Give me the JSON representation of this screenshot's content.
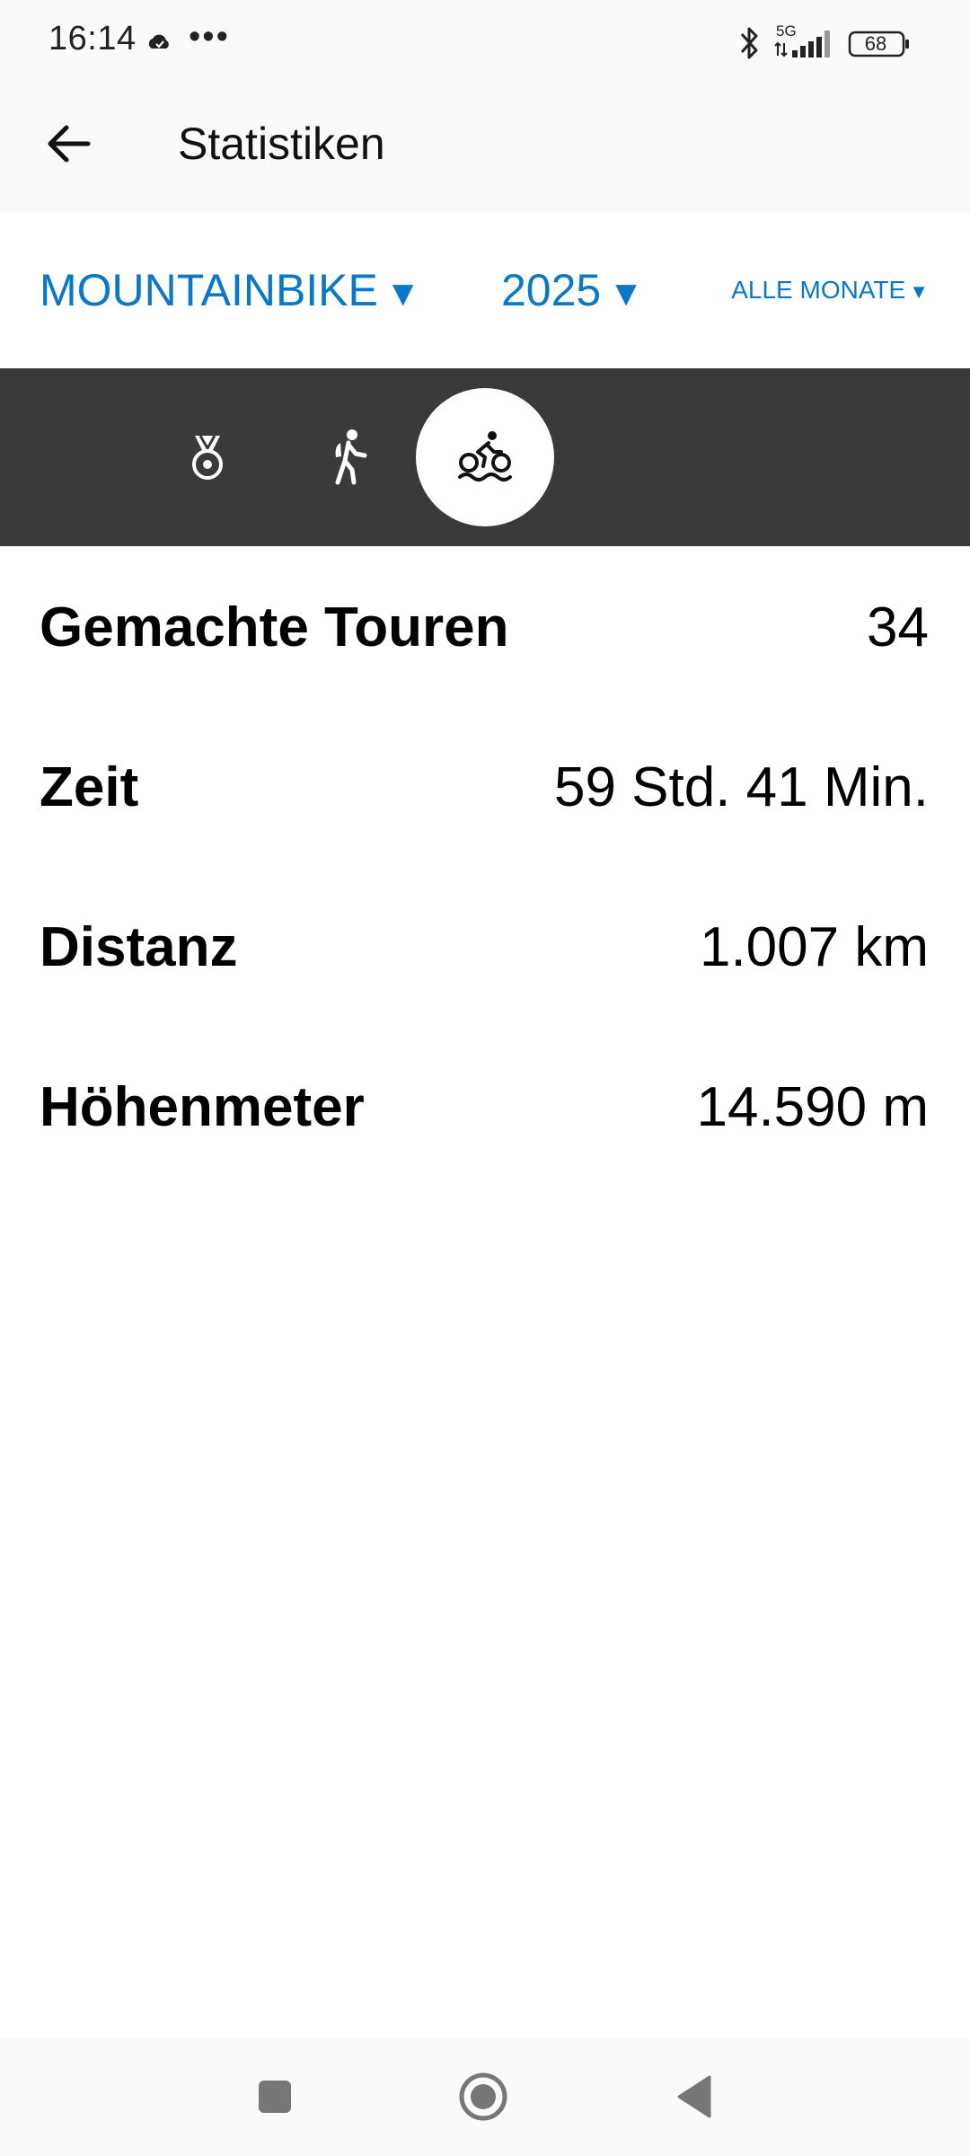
{
  "status_bar": {
    "time": "16:14",
    "dots": "•••",
    "battery": "68",
    "network": "5G",
    "icons": [
      "cloud-icon",
      "more-dots-icon",
      "bluetooth-icon",
      "signal-icon",
      "battery-icon"
    ]
  },
  "app_bar": {
    "title": "Statistiken",
    "back_icon": "arrow-left-icon"
  },
  "filters": {
    "sport": "MOUNTAINBIKE",
    "year": "2025",
    "month": "ALLE MONATE",
    "caret": "▼",
    "accent_color": "#0a78c8"
  },
  "tabs": [
    {
      "icon": "medal-icon",
      "selected": false
    },
    {
      "icon": "hiker-icon",
      "selected": false
    },
    {
      "icon": "bike-icon",
      "selected": true
    }
  ],
  "stats": [
    {
      "label": "Gemachte Touren",
      "value": "34"
    },
    {
      "label": "Zeit",
      "value": "59 Std. 41 Min."
    },
    {
      "label": "Distanz",
      "value": "1.007 km"
    },
    {
      "label": "Höhenmeter",
      "value": "14.590 m"
    }
  ],
  "nav_bar": {
    "icons": [
      "recents-square-icon",
      "home-circle-icon",
      "back-triangle-icon"
    ]
  },
  "colors": {
    "tab_bar_bg": "#3a3a3a",
    "header_bg": "#fafaf8",
    "accent": "#0a78c8"
  }
}
